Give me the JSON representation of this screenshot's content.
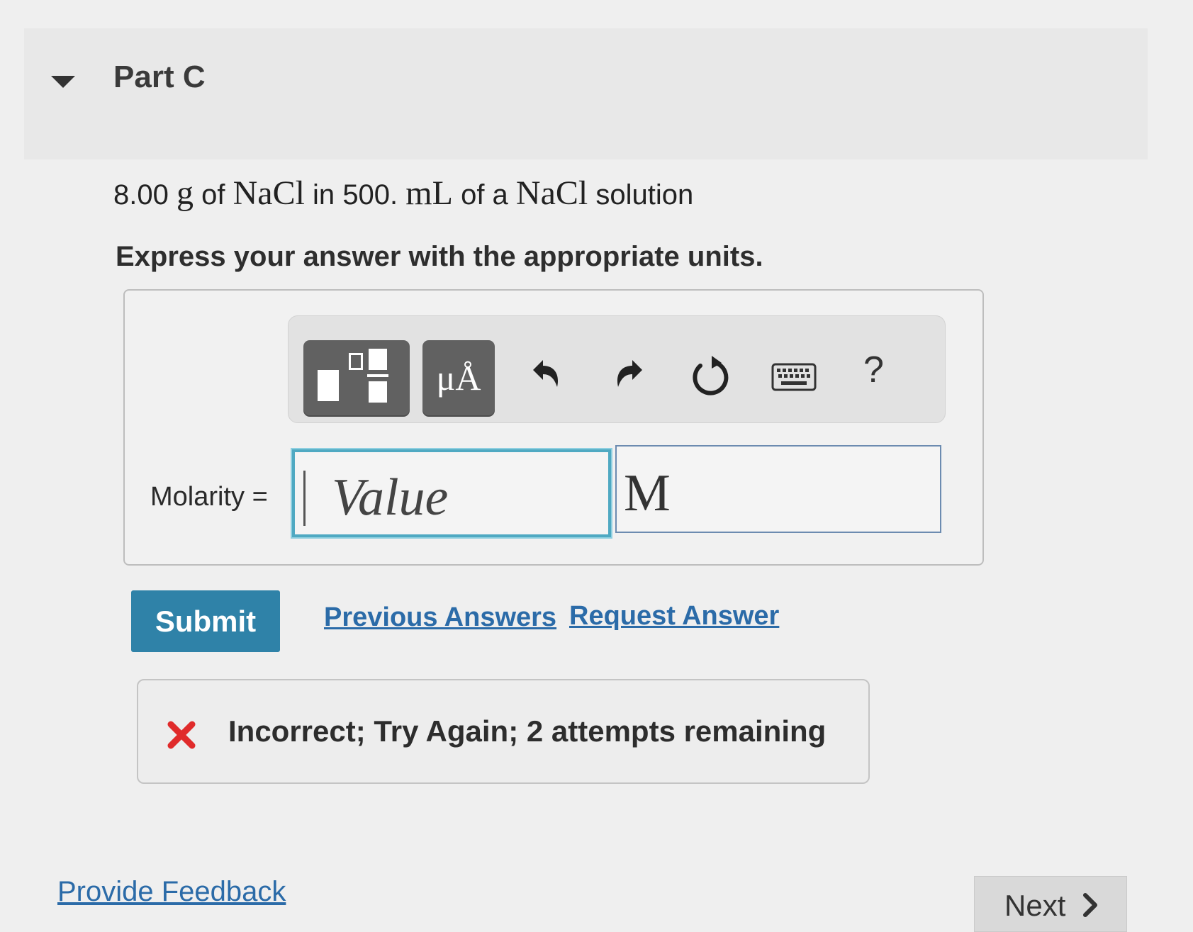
{
  "part": {
    "title": "Part C"
  },
  "problem": {
    "amount": "8.00",
    "unit_g": "g",
    "of_1": "of",
    "solute": "NaCl",
    "in": "in",
    "volume": "500.",
    "unit_ml": "mL",
    "of_a": "of a",
    "solution_formula": "NaCl",
    "solution_word": "solution"
  },
  "instruction": "Express your answer with the appropriate units.",
  "toolbar": {
    "templates_icon": "templates-icon",
    "units_label": "μÅ",
    "undo_icon": "undo-icon",
    "redo_icon": "redo-icon",
    "reset_icon": "reset-icon",
    "keyboard_icon": "keyboard-icon",
    "help_label": "?"
  },
  "answer": {
    "label": "Molarity =",
    "value_placeholder": "Value",
    "value": "",
    "units_value": "M"
  },
  "actions": {
    "submit_label": "Submit",
    "previous_answers_label": "Previous Answers",
    "request_answer_label": "Request Answer"
  },
  "feedback": {
    "message": "Incorrect; Try Again; 2 attempts remaining",
    "status_color": "#e02b2b"
  },
  "footer": {
    "provide_feedback_label": "Provide Feedback",
    "next_label": "Next"
  },
  "colors": {
    "accent": "#2f82a8",
    "link": "#2b6ba8",
    "input_focus": "#4fa9c2"
  }
}
